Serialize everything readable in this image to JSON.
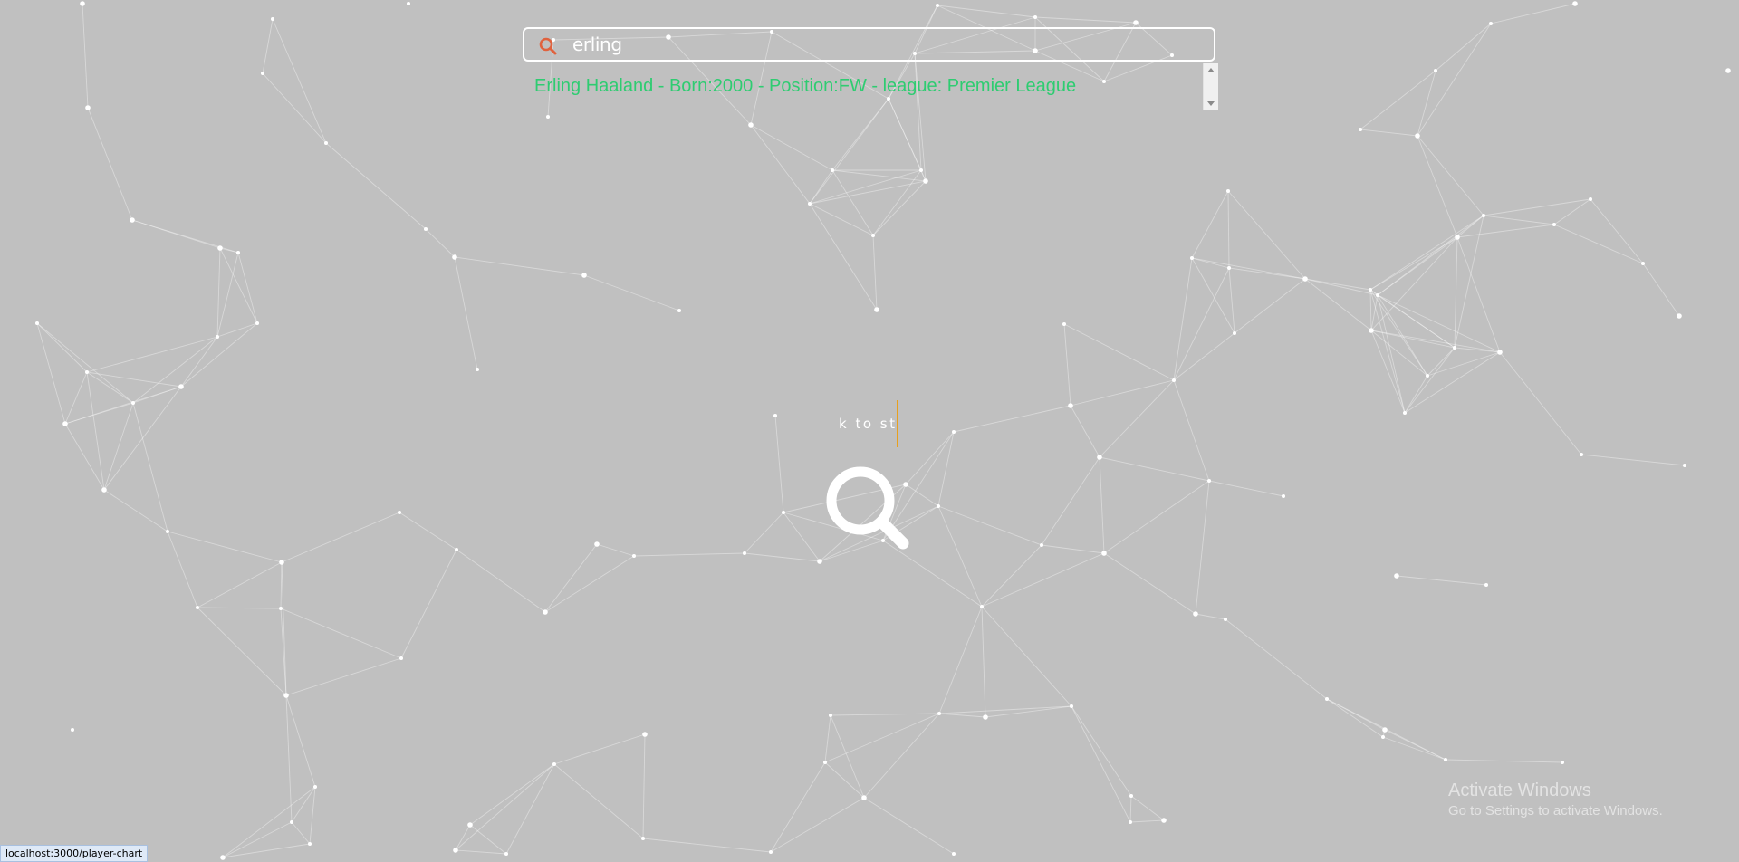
{
  "colors": {
    "background": "#c0c0c0",
    "accent_search_icon": "#e0623e",
    "suggestion_text": "#2ecc71",
    "cursor": "#e8a01e",
    "network": "#ffffff"
  },
  "search": {
    "icon": "search-icon",
    "value": "erling"
  },
  "suggestions": [
    {
      "label": "Erling Haaland - Born:2000 - Position:FW - league: Premier League"
    }
  ],
  "center": {
    "hint": "k to st",
    "icon": "magnifier-icon"
  },
  "status_bar": {
    "url": "localhost:3000/player-chart"
  },
  "watermark": {
    "title": "Activate Windows",
    "subtitle": "Go to Settings to activate Windows."
  }
}
